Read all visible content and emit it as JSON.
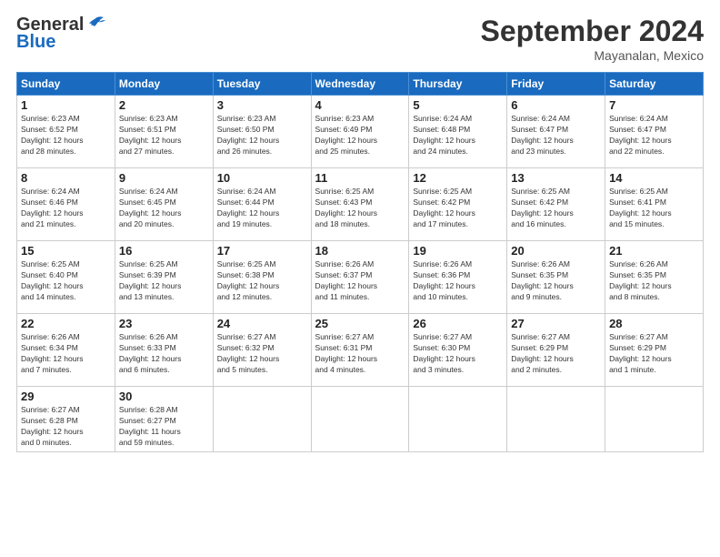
{
  "header": {
    "logo_line1": "General",
    "logo_line2": "Blue",
    "month": "September 2024",
    "location": "Mayanalan, Mexico"
  },
  "weekdays": [
    "Sunday",
    "Monday",
    "Tuesday",
    "Wednesday",
    "Thursday",
    "Friday",
    "Saturday"
  ],
  "weeks": [
    [
      {
        "day": "1",
        "sunrise": "6:23 AM",
        "sunset": "6:52 PM",
        "daylight": "12 hours and 28 minutes."
      },
      {
        "day": "2",
        "sunrise": "6:23 AM",
        "sunset": "6:51 PM",
        "daylight": "12 hours and 27 minutes."
      },
      {
        "day": "3",
        "sunrise": "6:23 AM",
        "sunset": "6:50 PM",
        "daylight": "12 hours and 26 minutes."
      },
      {
        "day": "4",
        "sunrise": "6:23 AM",
        "sunset": "6:49 PM",
        "daylight": "12 hours and 25 minutes."
      },
      {
        "day": "5",
        "sunrise": "6:24 AM",
        "sunset": "6:48 PM",
        "daylight": "12 hours and 24 minutes."
      },
      {
        "day": "6",
        "sunrise": "6:24 AM",
        "sunset": "6:47 PM",
        "daylight": "12 hours and 23 minutes."
      },
      {
        "day": "7",
        "sunrise": "6:24 AM",
        "sunset": "6:47 PM",
        "daylight": "12 hours and 22 minutes."
      }
    ],
    [
      {
        "day": "8",
        "sunrise": "6:24 AM",
        "sunset": "6:46 PM",
        "daylight": "12 hours and 21 minutes."
      },
      {
        "day": "9",
        "sunrise": "6:24 AM",
        "sunset": "6:45 PM",
        "daylight": "12 hours and 20 minutes."
      },
      {
        "day": "10",
        "sunrise": "6:24 AM",
        "sunset": "6:44 PM",
        "daylight": "12 hours and 19 minutes."
      },
      {
        "day": "11",
        "sunrise": "6:25 AM",
        "sunset": "6:43 PM",
        "daylight": "12 hours and 18 minutes."
      },
      {
        "day": "12",
        "sunrise": "6:25 AM",
        "sunset": "6:42 PM",
        "daylight": "12 hours and 17 minutes."
      },
      {
        "day": "13",
        "sunrise": "6:25 AM",
        "sunset": "6:42 PM",
        "daylight": "12 hours and 16 minutes."
      },
      {
        "day": "14",
        "sunrise": "6:25 AM",
        "sunset": "6:41 PM",
        "daylight": "12 hours and 15 minutes."
      }
    ],
    [
      {
        "day": "15",
        "sunrise": "6:25 AM",
        "sunset": "6:40 PM",
        "daylight": "12 hours and 14 minutes."
      },
      {
        "day": "16",
        "sunrise": "6:25 AM",
        "sunset": "6:39 PM",
        "daylight": "12 hours and 13 minutes."
      },
      {
        "day": "17",
        "sunrise": "6:25 AM",
        "sunset": "6:38 PM",
        "daylight": "12 hours and 12 minutes."
      },
      {
        "day": "18",
        "sunrise": "6:26 AM",
        "sunset": "6:37 PM",
        "daylight": "12 hours and 11 minutes."
      },
      {
        "day": "19",
        "sunrise": "6:26 AM",
        "sunset": "6:36 PM",
        "daylight": "12 hours and 10 minutes."
      },
      {
        "day": "20",
        "sunrise": "6:26 AM",
        "sunset": "6:35 PM",
        "daylight": "12 hours and 9 minutes."
      },
      {
        "day": "21",
        "sunrise": "6:26 AM",
        "sunset": "6:35 PM",
        "daylight": "12 hours and 8 minutes."
      }
    ],
    [
      {
        "day": "22",
        "sunrise": "6:26 AM",
        "sunset": "6:34 PM",
        "daylight": "12 hours and 7 minutes."
      },
      {
        "day": "23",
        "sunrise": "6:26 AM",
        "sunset": "6:33 PM",
        "daylight": "12 hours and 6 minutes."
      },
      {
        "day": "24",
        "sunrise": "6:27 AM",
        "sunset": "6:32 PM",
        "daylight": "12 hours and 5 minutes."
      },
      {
        "day": "25",
        "sunrise": "6:27 AM",
        "sunset": "6:31 PM",
        "daylight": "12 hours and 4 minutes."
      },
      {
        "day": "26",
        "sunrise": "6:27 AM",
        "sunset": "6:30 PM",
        "daylight": "12 hours and 3 minutes."
      },
      {
        "day": "27",
        "sunrise": "6:27 AM",
        "sunset": "6:29 PM",
        "daylight": "12 hours and 2 minutes."
      },
      {
        "day": "28",
        "sunrise": "6:27 AM",
        "sunset": "6:29 PM",
        "daylight": "12 hours and 1 minute."
      }
    ],
    [
      {
        "day": "29",
        "sunrise": "6:27 AM",
        "sunset": "6:28 PM",
        "daylight": "12 hours and 0 minutes."
      },
      {
        "day": "30",
        "sunrise": "6:28 AM",
        "sunset": "6:27 PM",
        "daylight": "11 hours and 59 minutes."
      },
      null,
      null,
      null,
      null,
      null
    ]
  ]
}
